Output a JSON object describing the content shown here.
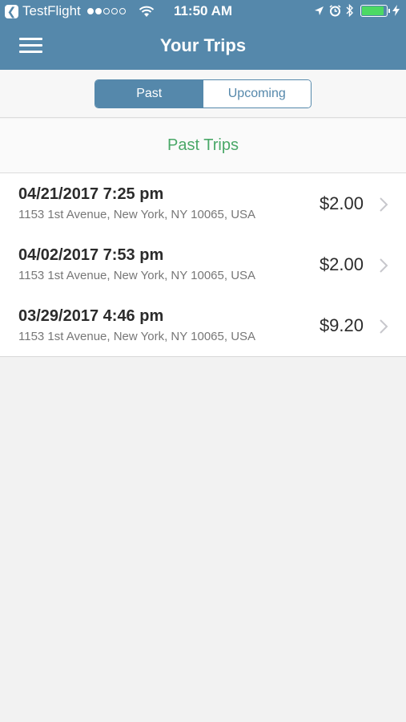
{
  "status_bar": {
    "back_app": "TestFlight",
    "time": "11:50 AM"
  },
  "nav": {
    "title": "Your Trips",
    "menu_icon": "hamburger-icon"
  },
  "segments": {
    "past": "Past",
    "upcoming": "Upcoming",
    "selected": "Past"
  },
  "section": {
    "title": "Past Trips"
  },
  "trips": [
    {
      "datetime": "04/21/2017 7:25 pm",
      "address": "1153 1st Avenue, New York, NY 10065, USA",
      "price": "$2.00"
    },
    {
      "datetime": "04/02/2017 7:53 pm",
      "address": "1153 1st Avenue, New York, NY 10065, USA",
      "price": "$2.00"
    },
    {
      "datetime": "03/29/2017 4:46 pm",
      "address": "1153 1st Avenue, New York, NY 10065, USA",
      "price": "$9.20"
    }
  ],
  "colors": {
    "primary": "#5588ab",
    "accent_green": "#4aa868",
    "battery_green": "#4cd964",
    "background": "#f2f2f2"
  }
}
